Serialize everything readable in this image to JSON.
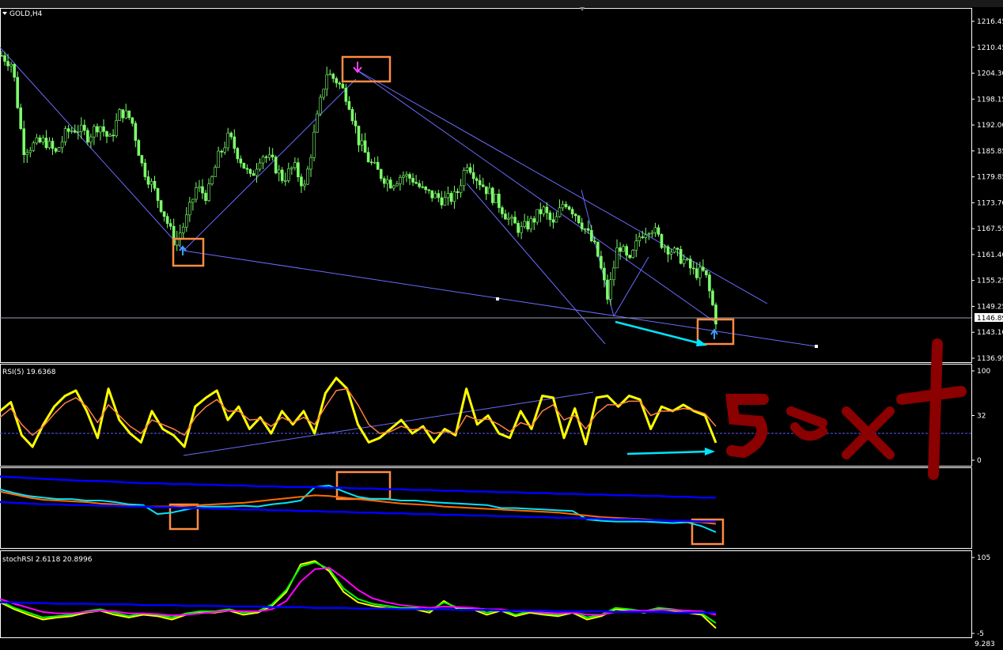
{
  "chart_data": [
    {
      "type": "candlestick",
      "title": "GOLD,H4",
      "y_ticks": [
        "1216.45",
        "1210.45",
        "1204.30",
        "1198.15",
        "1192.00",
        "1185.85",
        "1179.85",
        "1173.70",
        "1167.55",
        "1161.40",
        "1155.25",
        "1149.25",
        "1143.10",
        "1136.95"
      ],
      "current_price": "1146.89",
      "y_range": [
        1135.0,
        1218.0
      ],
      "close_path": [
        1207,
        1205,
        1185,
        1186,
        1187,
        1184,
        1189,
        1190,
        1188,
        1191,
        1187,
        1194,
        1192,
        1181,
        1176,
        1170,
        1163,
        1168,
        1176,
        1174,
        1183,
        1188,
        1183,
        1178,
        1184,
        1182,
        1178,
        1181,
        1176,
        1190,
        1203,
        1201,
        1197,
        1187,
        1182,
        1179,
        1177,
        1179,
        1178,
        1175,
        1174,
        1173,
        1174,
        1182,
        1178,
        1175,
        1172,
        1168,
        1166,
        1168,
        1171,
        1167,
        1173,
        1170,
        1166,
        1161,
        1150,
        1163,
        1158,
        1165,
        1167,
        1163,
        1161,
        1159,
        1156,
        1156,
        1145
      ],
      "markers": [
        {
          "type": "buy-arrow",
          "x_frac": 0.26,
          "price": 1162
        },
        {
          "type": "sell-arrow",
          "x_frac": 0.505,
          "price": 1207
        },
        {
          "type": "buy-arrow",
          "x_frac": 0.997,
          "price": 1143
        }
      ]
    },
    {
      "type": "line",
      "title": "RSI(5) 19.6368",
      "y_ticks": [
        "100",
        "32",
        "0"
      ],
      "y_range": [
        0,
        100
      ],
      "level": 32,
      "series": [
        {
          "name": "RSI(5)",
          "color": "#ffff00",
          "values": [
            55,
            65,
            28,
            15,
            40,
            60,
            72,
            78,
            55,
            25,
            80,
            45,
            30,
            20,
            55,
            35,
            28,
            15,
            60,
            70,
            78,
            45,
            60,
            35,
            48,
            30,
            55,
            40,
            55,
            30,
            75,
            92,
            80,
            40,
            20,
            25,
            35,
            45,
            30,
            38,
            20,
            35,
            28,
            80,
            40,
            50,
            30,
            25,
            55,
            35,
            72,
            70,
            25,
            58,
            18,
            70,
            72,
            60,
            72,
            68,
            35,
            60,
            55,
            62,
            55,
            50,
            19.6
          ]
        },
        {
          "name": "",
          "color": "#ff8040",
          "values": [
            48,
            58,
            40,
            28,
            38,
            52,
            64,
            70,
            60,
            42,
            62,
            50,
            38,
            30,
            45,
            40,
            35,
            28,
            48,
            60,
            68,
            55,
            55,
            45,
            46,
            38,
            48,
            42,
            48,
            40,
            60,
            78,
            80,
            62,
            40,
            30,
            32,
            38,
            34,
            36,
            30,
            32,
            30,
            50,
            45,
            46,
            40,
            32,
            42,
            38,
            55,
            62,
            45,
            50,
            35,
            52,
            62,
            62,
            66,
            66,
            50,
            55,
            55,
            58,
            56,
            52,
            38
          ]
        }
      ],
      "annotation": "5ext"
    },
    {
      "type": "line",
      "title": "",
      "y_range": [
        0,
        100
      ],
      "series": [
        {
          "name": "",
          "color": "#00e5ff",
          "values": [
            75,
            70,
            66,
            64,
            62,
            62,
            60,
            60,
            58,
            55,
            54,
            42,
            44,
            48,
            52,
            52,
            52,
            53,
            52,
            55,
            57,
            60,
            78,
            80,
            72,
            65,
            62,
            62,
            60,
            60,
            58,
            57,
            56,
            55,
            54,
            50,
            50,
            49,
            48,
            47,
            46,
            35,
            33,
            32,
            32,
            32,
            31,
            30,
            31,
            26,
            18
          ]
        },
        {
          "name": "",
          "color": "#ff6a00",
          "values": [
            72,
            68,
            64,
            61,
            60,
            59,
            58,
            56,
            55,
            53,
            52,
            52,
            52,
            53,
            54,
            55,
            56,
            57,
            59,
            61,
            63,
            65,
            67,
            66,
            64,
            62,
            60,
            58,
            56,
            55,
            54,
            52,
            51,
            50,
            49,
            48,
            47,
            46,
            45,
            44,
            42,
            40,
            38,
            37,
            36,
            35,
            34,
            33,
            32,
            31,
            29
          ]
        },
        {
          "name": "",
          "color": "#0000ff",
          "values": [
            92,
            91,
            90,
            89,
            88,
            87,
            86,
            86,
            85,
            84,
            83,
            83,
            82,
            82,
            81,
            81,
            80,
            80,
            79,
            79,
            78,
            78,
            78,
            77,
            77,
            76,
            76,
            75,
            75,
            74,
            74,
            73,
            73,
            72,
            72,
            71,
            71,
            70,
            70,
            69,
            69,
            68,
            68,
            67,
            67,
            66,
            66,
            65,
            65,
            64,
            64
          ]
        },
        {
          "name": "",
          "color": "#0000ff",
          "values": [
            58,
            57,
            56,
            55,
            55,
            54,
            54,
            53,
            53,
            52,
            52,
            51,
            51,
            50,
            50,
            49,
            49,
            48,
            48,
            47,
            47,
            46,
            46,
            45,
            45,
            44,
            44,
            43,
            43,
            42,
            42,
            41,
            41,
            40,
            40,
            39,
            39,
            38,
            38,
            37,
            37,
            36,
            36,
            35,
            35,
            34,
            34,
            33,
            33,
            32,
            32
          ]
        }
      ]
    },
    {
      "type": "line",
      "title": "stochRSI 2.6118 20.8996",
      "y_ticks": [
        "105",
        "-5"
      ],
      "y_range": [
        -5,
        105
      ],
      "series": [
        {
          "name": "",
          "color": "#ffff00",
          "values": [
            40,
            30,
            22,
            15,
            18,
            20,
            25,
            28,
            22,
            18,
            22,
            20,
            15,
            22,
            25,
            25,
            28,
            22,
            25,
            35,
            55,
            95,
            100,
            85,
            55,
            40,
            35,
            32,
            30,
            30,
            25,
            42,
            30,
            30,
            22,
            28,
            20,
            25,
            22,
            20,
            25,
            15,
            20,
            30,
            28,
            25,
            30,
            28,
            25,
            22,
            2.6
          ]
        },
        {
          "name": "",
          "color": "#00ff00",
          "values": [
            42,
            32,
            25,
            18,
            20,
            22,
            27,
            30,
            25,
            20,
            24,
            22,
            18,
            24,
            27,
            27,
            30,
            25,
            27,
            37,
            58,
            92,
            98,
            88,
            60,
            45,
            38,
            35,
            32,
            32,
            28,
            40,
            32,
            32,
            25,
            30,
            22,
            27,
            24,
            22,
            27,
            18,
            22,
            32,
            30,
            27,
            32,
            30,
            27,
            24,
            10
          ]
        },
        {
          "name": "",
          "color": "#ff00ff",
          "values": [
            45,
            38,
            32,
            26,
            24,
            24,
            26,
            28,
            27,
            24,
            24,
            23,
            21,
            22,
            24,
            26,
            28,
            27,
            27,
            30,
            42,
            70,
            88,
            90,
            75,
            58,
            46,
            40,
            36,
            34,
            32,
            34,
            33,
            32,
            30,
            30,
            27,
            27,
            25,
            24,
            25,
            22,
            22,
            26,
            28,
            28,
            29,
            29,
            28,
            27,
            22
          ]
        },
        {
          "name": "",
          "color": "#0000ff",
          "values": [
            40,
            40,
            39,
            39,
            38,
            38,
            38,
            37,
            37,
            37,
            36,
            36,
            36,
            35,
            35,
            35,
            34,
            34,
            34,
            33,
            33,
            33,
            32,
            32,
            32,
            31,
            31,
            31,
            30,
            30,
            30,
            30,
            29,
            29,
            29,
            28,
            28,
            28,
            28,
            27,
            27,
            27,
            27,
            26,
            26,
            26,
            26,
            25,
            25,
            25,
            25
          ]
        }
      ]
    }
  ]
}
